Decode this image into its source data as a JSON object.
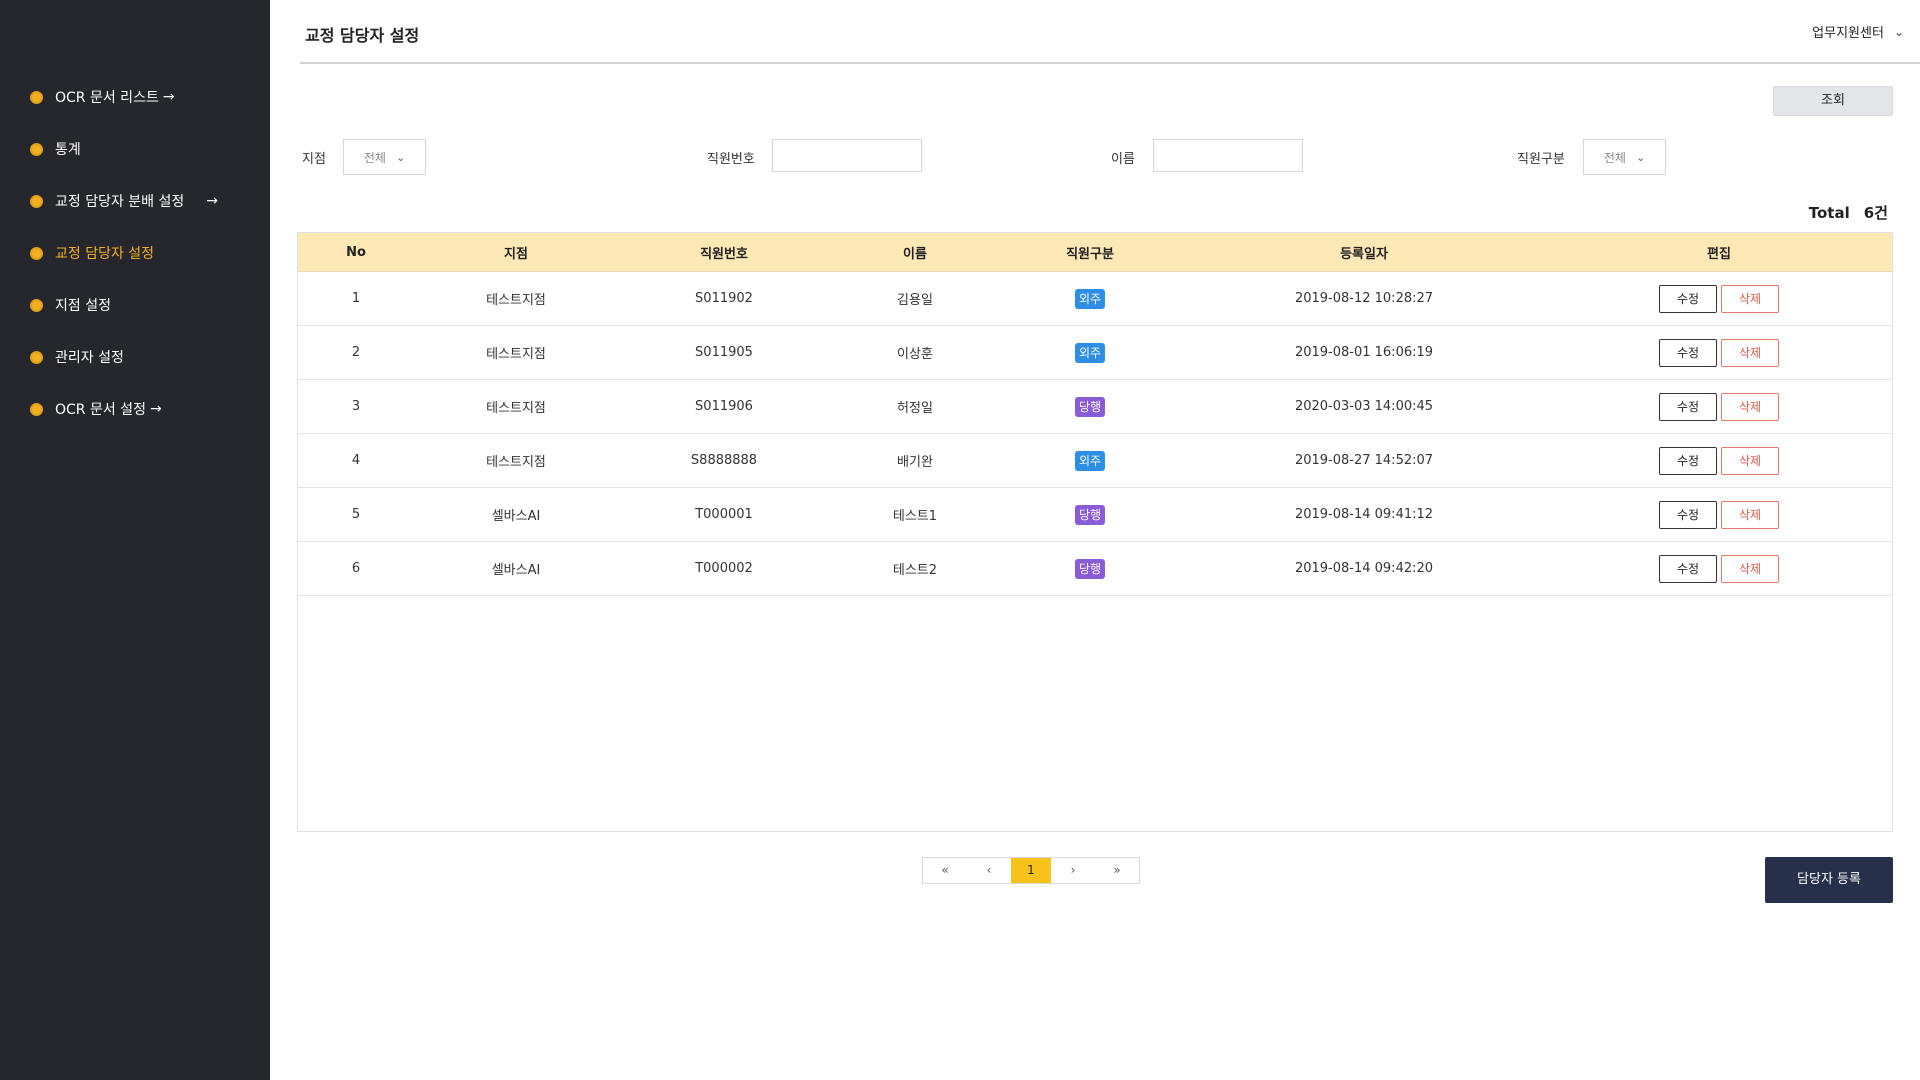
{
  "sidebar": {
    "items": [
      {
        "label": "OCR 문서 리스트",
        "arrow": "→"
      },
      {
        "label": "통계",
        "arrow": ""
      },
      {
        "label": "교정 담당자 분배 설정",
        "arrow": "→"
      },
      {
        "label": "교정 담당자 설정",
        "arrow": ""
      },
      {
        "label": "지점 설정",
        "arrow": ""
      },
      {
        "label": "관리자 설정",
        "arrow": ""
      },
      {
        "label": "OCR 문서 설정",
        "arrow": "→"
      }
    ],
    "active_index": 3
  },
  "header": {
    "title": "교정 담당자 설정",
    "org": "업무지원센터",
    "org_icon": "chevron-down-icon"
  },
  "search": {
    "button_label": "조회"
  },
  "filters": {
    "branch_label": "지점",
    "branch_value": "전체",
    "emp_no_label": "직원번호",
    "emp_no_value": "",
    "name_label": "이름",
    "name_value": "",
    "type_label": "직원구분",
    "type_value": "전체"
  },
  "total": {
    "label": "Total",
    "count": "6건"
  },
  "table": {
    "headers": [
      "No",
      "지점",
      "직원번호",
      "이름",
      "직원구분",
      "등록일자",
      "편집"
    ],
    "rows": [
      {
        "no": "1",
        "branch": "테스트지점",
        "emp_no": "S011902",
        "name": "김용일",
        "type": "외주",
        "type_color": "#2e8de4",
        "date": "2019-08-12 10:28:27"
      },
      {
        "no": "2",
        "branch": "테스트지점",
        "emp_no": "S011905",
        "name": "이상훈",
        "type": "외주",
        "type_color": "#2e8de4",
        "date": "2019-08-01 16:06:19"
      },
      {
        "no": "3",
        "branch": "테스트지점",
        "emp_no": "S011906",
        "name": "허정일",
        "type": "당행",
        "type_color": "#8a5bd6",
        "date": "2020-03-03 14:00:45"
      },
      {
        "no": "4",
        "branch": "테스트지점",
        "emp_no": "S8888888",
        "name": "배기완",
        "type": "외주",
        "type_color": "#2e8de4",
        "date": "2019-08-27 14:52:07"
      },
      {
        "no": "5",
        "branch": "셀바스AI",
        "emp_no": "T000001",
        "name": "테스트1",
        "type": "당행",
        "type_color": "#8a5bd6",
        "date": "2019-08-14 09:41:12"
      },
      {
        "no": "6",
        "branch": "셀바스AI",
        "emp_no": "T000002",
        "name": "테스트2",
        "type": "당행",
        "type_color": "#8a5bd6",
        "date": "2019-08-14 09:42:20"
      }
    ],
    "edit_label": "수정",
    "delete_label": "삭제"
  },
  "pagination": {
    "first": "«",
    "prev": "‹",
    "current": "1",
    "next": "›",
    "last": "»"
  },
  "register_button": "담당자 등록",
  "colors": {
    "sidebar_bg": "#26272c",
    "accent": "#f5b021",
    "table_header_bg": "#fde8b6",
    "badge_outsource": "#2e8de4",
    "badge_internal": "#8a5bd6",
    "register_bg": "#26304a"
  }
}
